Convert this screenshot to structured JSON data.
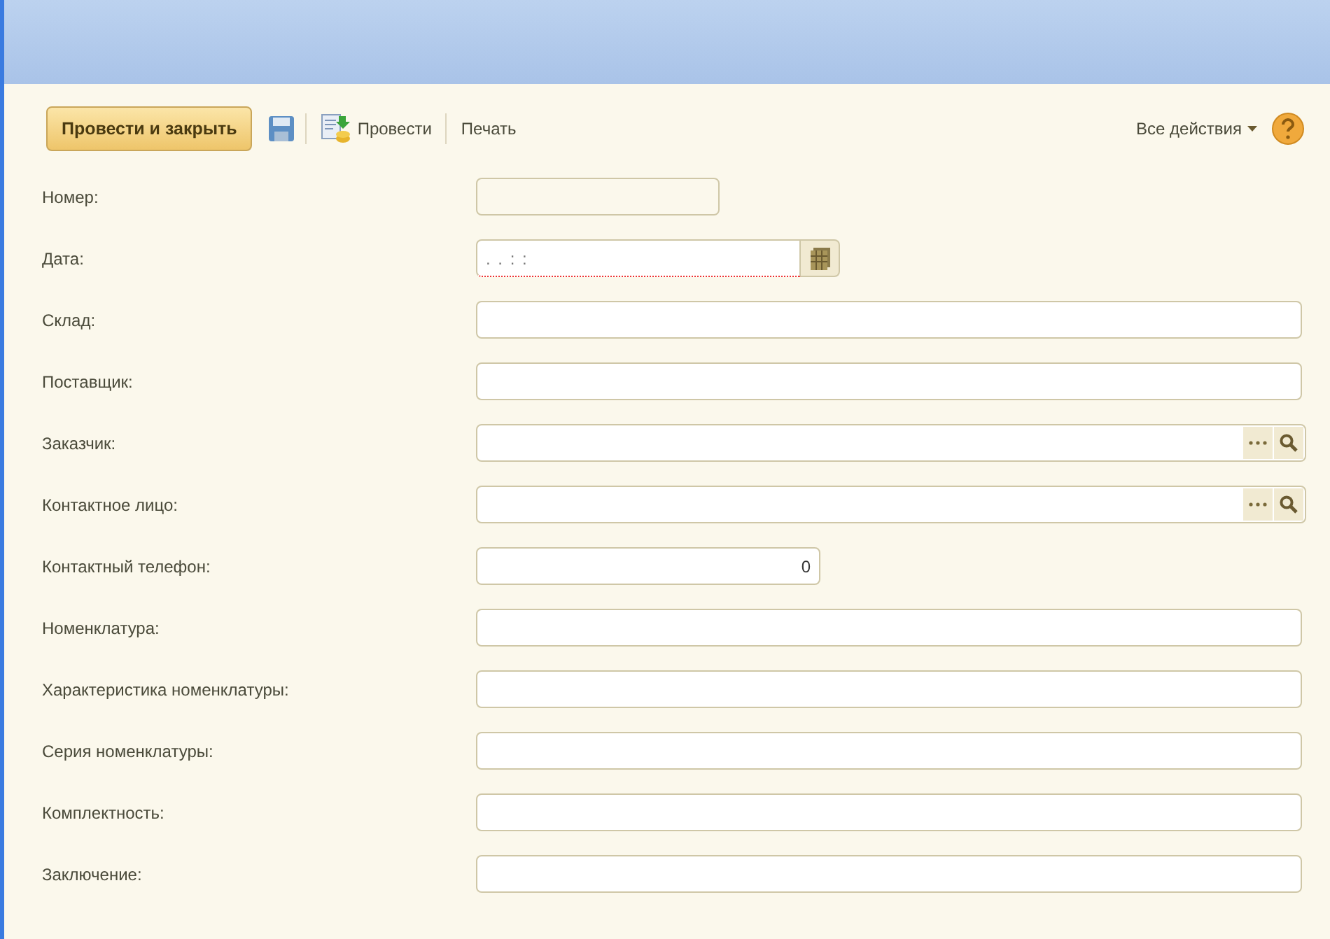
{
  "toolbar": {
    "primary_button": "Провести и закрыть",
    "post_button": "Провести",
    "print_button": "Печать",
    "all_actions": "Все действия"
  },
  "fields": [
    {
      "label": "Номер:",
      "kind": "short",
      "required": false
    },
    {
      "label": "Дата:",
      "kind": "date",
      "value": ". .   : :",
      "required": true
    },
    {
      "label": "Склад:",
      "kind": "text",
      "required": false
    },
    {
      "label": "Поставщик:",
      "kind": "text",
      "required": false
    },
    {
      "label": "Заказчик:",
      "kind": "select",
      "required": false
    },
    {
      "label": "Контактное лицо:",
      "kind": "select",
      "required": false
    },
    {
      "label": "Контактный телефон:",
      "kind": "number",
      "value": "0",
      "required": false
    },
    {
      "label": "Номенклатура:",
      "kind": "text",
      "required": false
    },
    {
      "label": "Характеристика номенклатуры:",
      "kind": "text",
      "required": false
    },
    {
      "label": "Серия номенклатуры:",
      "kind": "text",
      "required": false
    },
    {
      "label": "Комплектность:",
      "kind": "text",
      "required": false
    },
    {
      "label": "Заключение:",
      "kind": "text",
      "required": false
    }
  ]
}
